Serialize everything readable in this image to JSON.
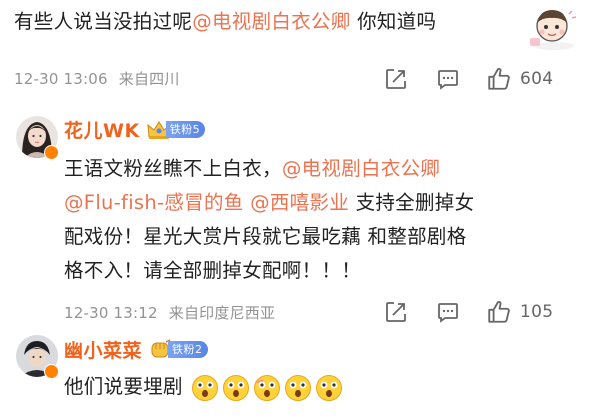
{
  "comment1": {
    "text_plain": "有些人说当没拍过呢",
    "mention": "@电视剧白衣公卿",
    "text_after": " 你知道吗",
    "timestamp": "12-30 13:06",
    "location": "来自四川",
    "like_count": "604"
  },
  "comment2": {
    "author": "花儿WK",
    "fan_badge": "铁粉5",
    "line1_plain": "王语文粉丝瞧不上白衣，",
    "mention1": "@电视剧白衣公卿",
    "mention2": "@Flu-fish-感冒的鱼",
    "mention3": "@西嘻影业",
    "line2_after": " 支持全删掉女",
    "line3": "配戏份！星光大赏片段就它最吃藕 和整部剧格",
    "line4": "格不入！请全部删掉女配啊！！！",
    "timestamp": "12-30 13:12",
    "location": "来自印度尼西亚",
    "like_count": "105"
  },
  "comment3": {
    "author": "幽小菜菜",
    "fan_badge": "铁粉2",
    "text": "他们说要埋剧",
    "emoji_icon": "shocked-face-emoji"
  },
  "colors": {
    "mention": "#eb7350",
    "username": "#f0631e",
    "meta": "#939393",
    "fan_badge": "#6b93ec"
  }
}
